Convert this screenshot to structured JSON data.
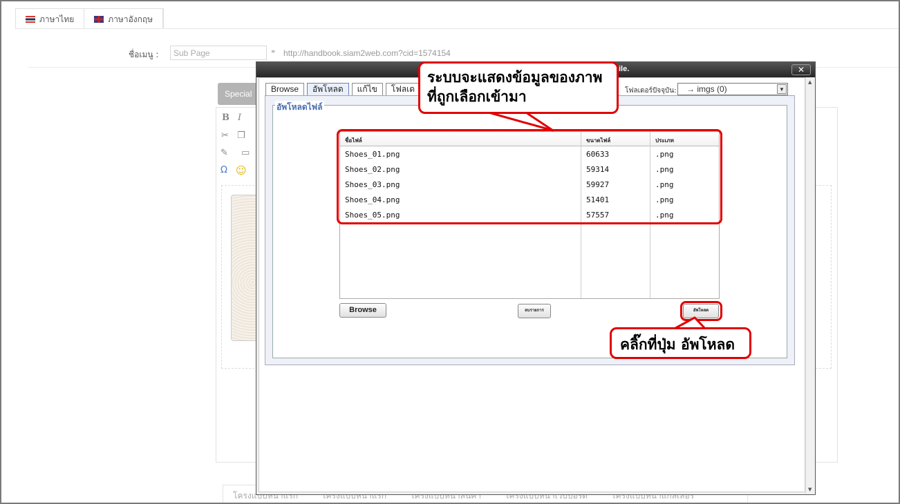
{
  "lang_tabs": [
    {
      "label": "ภาษาไทย",
      "icon": "thai-flag-icon"
    },
    {
      "label": "ภาษาอังกฤษ",
      "icon": "uk-flag-icon"
    }
  ],
  "menu": {
    "label": "ชื่อเมนู :",
    "value": "Sub Page",
    "url": "http://handbook.siam2web.com?cid=1574154"
  },
  "editor": {
    "special_label": "Special"
  },
  "bottom_tabs": [
    "โครงแบบหน้าแรก",
    "โครงแบบหน้าแรก",
    "โครงแบบหน้าสินค้า",
    "โครงแบบหน้าเว็บบอร์ด",
    "โครงแบบหน้าแกลเลอรี่"
  ],
  "modal": {
    "title": "ile.",
    "close_label": "✕",
    "tabs": [
      "Browse",
      "อัพโหลด",
      "แก้ไข",
      "โฟลเด"
    ],
    "active_tab": "อัพโหลด",
    "folder_label": "โฟลเดอร์ปัจจุบัน:",
    "folder_value": "→ imgs (0)",
    "legend": "อัพโหลดไฟล์",
    "columns": [
      "ชื่อไฟล์",
      "ขนาดไฟล์",
      "ประเภท"
    ],
    "files": [
      {
        "name": "Shoes_01.png",
        "size": "60633",
        "type": ".png"
      },
      {
        "name": "Shoes_02.png",
        "size": "59314",
        "type": ".png"
      },
      {
        "name": "Shoes_03.png",
        "size": "59927",
        "type": ".png"
      },
      {
        "name": "Shoes_04.png",
        "size": "51401",
        "type": ".png"
      },
      {
        "name": "Shoes_05.png",
        "size": "57557",
        "type": ".png"
      }
    ],
    "browse_button": "Browse",
    "clear_button": "ลบรายการ",
    "upload_button": "อัพโหลด"
  },
  "annotations": {
    "top_line1": "ระบบจะแสดงข้อมูลของภาพ",
    "top_line2": "ที่ถูกเลือกเข้ามา",
    "bottom": "คลิ๊กที่ปุ่ม อัพโหลด",
    "color": "#e00000"
  }
}
